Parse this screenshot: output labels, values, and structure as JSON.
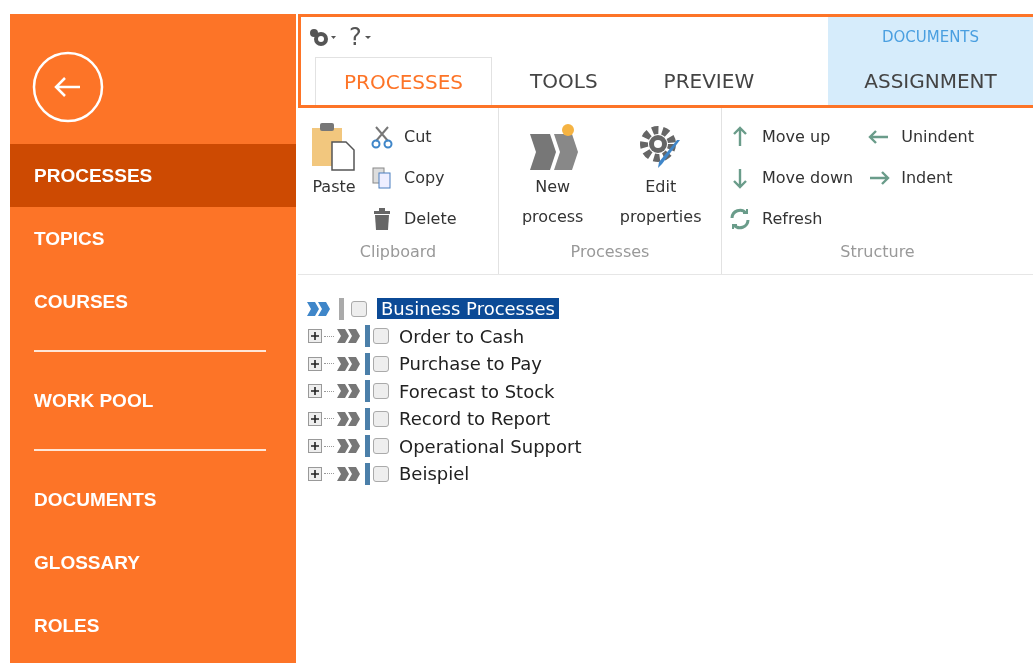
{
  "sidebar": {
    "items": [
      {
        "kind": "item",
        "label": "PROCESSES",
        "selected": true
      },
      {
        "kind": "item",
        "label": "TOPICS",
        "selected": false
      },
      {
        "kind": "item",
        "label": "COURSES",
        "selected": false
      },
      {
        "kind": "divider"
      },
      {
        "kind": "item",
        "label": "WORK POOL",
        "selected": false
      },
      {
        "kind": "divider"
      },
      {
        "kind": "item",
        "label": "DOCUMENTS",
        "selected": false
      },
      {
        "kind": "item",
        "label": "GLOSSARY",
        "selected": false
      },
      {
        "kind": "item",
        "label": "ROLES",
        "selected": false
      }
    ]
  },
  "quick_access": {
    "help_label": "?"
  },
  "ribbon": {
    "context_label": "DOCUMENTS",
    "tabs": [
      {
        "label": "PROCESSES",
        "selected": true
      },
      {
        "label": "TOOLS",
        "selected": false
      },
      {
        "label": "PREVIEW",
        "selected": false
      },
      {
        "label": "ASSIGNMENT",
        "selected": false,
        "contextual": true
      }
    ],
    "groups": [
      {
        "name": "Clipboard",
        "large": [
          "Paste"
        ],
        "small": [
          "Cut",
          "Copy",
          "Delete"
        ]
      },
      {
        "name": "Processes",
        "large": [
          "New process",
          "Edit properties"
        ]
      },
      {
        "name": "Structure",
        "small": [
          "Move up",
          "Move down",
          "Refresh",
          "Unindent",
          "Indent"
        ]
      }
    ]
  },
  "tree": {
    "label": "Business Processes",
    "selected": true,
    "checked": false,
    "expanded": true,
    "children": [
      {
        "label": "Order to Cash",
        "selected": false,
        "checked": false,
        "expanded": false
      },
      {
        "label": "Purchase to Pay",
        "selected": false,
        "checked": false,
        "expanded": false
      },
      {
        "label": "Forecast to Stock",
        "selected": false,
        "checked": false,
        "expanded": false
      },
      {
        "label": "Record to Report",
        "selected": false,
        "checked": false,
        "expanded": false
      },
      {
        "label": "Operational Support",
        "selected": false,
        "checked": false,
        "expanded": false
      },
      {
        "label": "Beispiel",
        "selected": false,
        "checked": false,
        "expanded": false
      }
    ]
  }
}
